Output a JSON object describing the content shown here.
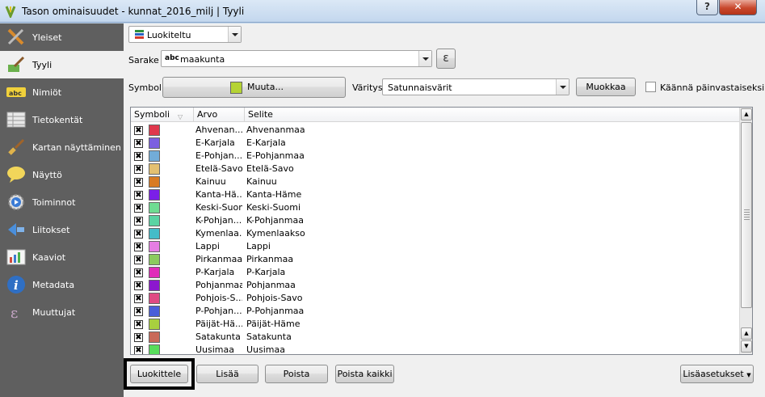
{
  "window": {
    "title": "Tason ominaisuudet - kunnat_2016_milj | Tyyli",
    "help_label": "?",
    "close_label": "✕"
  },
  "sidebar": {
    "items": [
      {
        "label": "Yleiset",
        "icon": "tools-icon",
        "active": false
      },
      {
        "label": "Tyyli",
        "icon": "paint-brush-icon",
        "active": true
      },
      {
        "label": "Nimiöt",
        "icon": "abc-label-icon",
        "active": false
      },
      {
        "label": "Tietokentät",
        "icon": "table-fields-icon",
        "active": false
      },
      {
        "label": "Kartan näyttäminen",
        "icon": "brush-icon",
        "active": false
      },
      {
        "label": "Näyttö",
        "icon": "speech-bubble-icon",
        "active": false
      },
      {
        "label": "Toiminnot",
        "icon": "gear-play-icon",
        "active": false
      },
      {
        "label": "Liitokset",
        "icon": "join-arrow-icon",
        "active": false
      },
      {
        "label": "Kaaviot",
        "icon": "diagram-icon",
        "active": false
      },
      {
        "label": "Metadata",
        "icon": "info-icon",
        "active": false
      },
      {
        "label": "Muuttujat",
        "icon": "epsilon-icon",
        "active": false
      }
    ]
  },
  "renderer": {
    "selected": "Luokiteltu"
  },
  "column": {
    "label": "Sarake",
    "type_badge": "abc",
    "value": "maakunta",
    "expr_label": "ε"
  },
  "symbol": {
    "label": "Symboli",
    "button_label": "Muuta...",
    "swatch_color": "#b5d334"
  },
  "colors": {
    "label": "Väritys",
    "value": "Satunnaisvärit",
    "edit_label": "Muokkaa",
    "invert_label": "Käännä päinvastaiseksi"
  },
  "table": {
    "headers": [
      "Symboli",
      "Arvo",
      "Selite"
    ],
    "rows": [
      {
        "value": "Ahvenan...",
        "legend": "Ahvenanmaa",
        "color": "#e0384c"
      },
      {
        "value": "E-Karjala",
        "legend": "E-Karjala",
        "color": "#7b5fe0"
      },
      {
        "value": "E-Pohjan...",
        "legend": "E-Pohjanmaa",
        "color": "#72acd8"
      },
      {
        "value": "Etelä-Savo",
        "legend": "Etelä-Savo",
        "color": "#e3c071"
      },
      {
        "value": "Kainuu",
        "legend": "Kainuu",
        "color": "#d97b22"
      },
      {
        "value": "Kanta-Hä...",
        "legend": "Kanta-Häme",
        "color": "#7b1fe8"
      },
      {
        "value": "Keski-Suomi",
        "legend": "Keski-Suomi",
        "color": "#6fdc92"
      },
      {
        "value": "K-Pohjan...",
        "legend": "K-Pohjanmaa",
        "color": "#5ad3a3"
      },
      {
        "value": "Kymenlaa...",
        "legend": "Kymenlaakso",
        "color": "#44bcc8"
      },
      {
        "value": "Lappi",
        "legend": "Lappi",
        "color": "#e57ee3"
      },
      {
        "value": "Pirkanmaa",
        "legend": "Pirkanmaa",
        "color": "#8bcb5e"
      },
      {
        "value": "P-Karjala",
        "legend": "P-Karjala",
        "color": "#e02bb9"
      },
      {
        "value": "Pohjanmaa",
        "legend": "Pohjanmaa",
        "color": "#8c17cf"
      },
      {
        "value": "Pohjois-S...",
        "legend": "Pohjois-Savo",
        "color": "#df4a83"
      },
      {
        "value": "P-Pohjan...",
        "legend": "P-Pohjanmaa",
        "color": "#4a5ed9"
      },
      {
        "value": "Päijät-Hä...",
        "legend": "Päijät-Häme",
        "color": "#a8cf3f"
      },
      {
        "value": "Satakunta",
        "legend": "Satakunta",
        "color": "#c96a59"
      },
      {
        "value": "Uusimaa",
        "legend": "Uusimaa",
        "color": "#58dd5b"
      }
    ]
  },
  "buttons": {
    "classify": "Luokittele",
    "add": "Lisää",
    "remove": "Poista",
    "remove_all": "Poista kaikki",
    "advanced": "Lisäasetukset"
  }
}
